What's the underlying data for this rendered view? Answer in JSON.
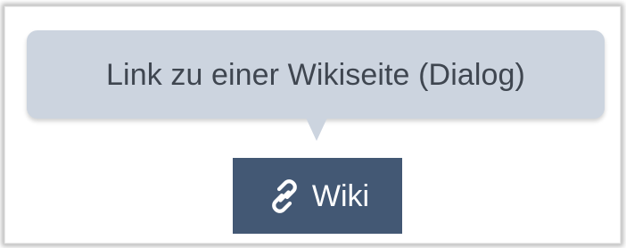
{
  "tooltip": {
    "text": "Link zu einer Wikiseite (Dialog)"
  },
  "button": {
    "label": "Wiki",
    "icon": "link-icon"
  },
  "colors": {
    "tooltip_bg": "#ccd4df",
    "tooltip_text": "#3f4650",
    "button_bg": "#435874",
    "button_text": "#ffffff"
  }
}
